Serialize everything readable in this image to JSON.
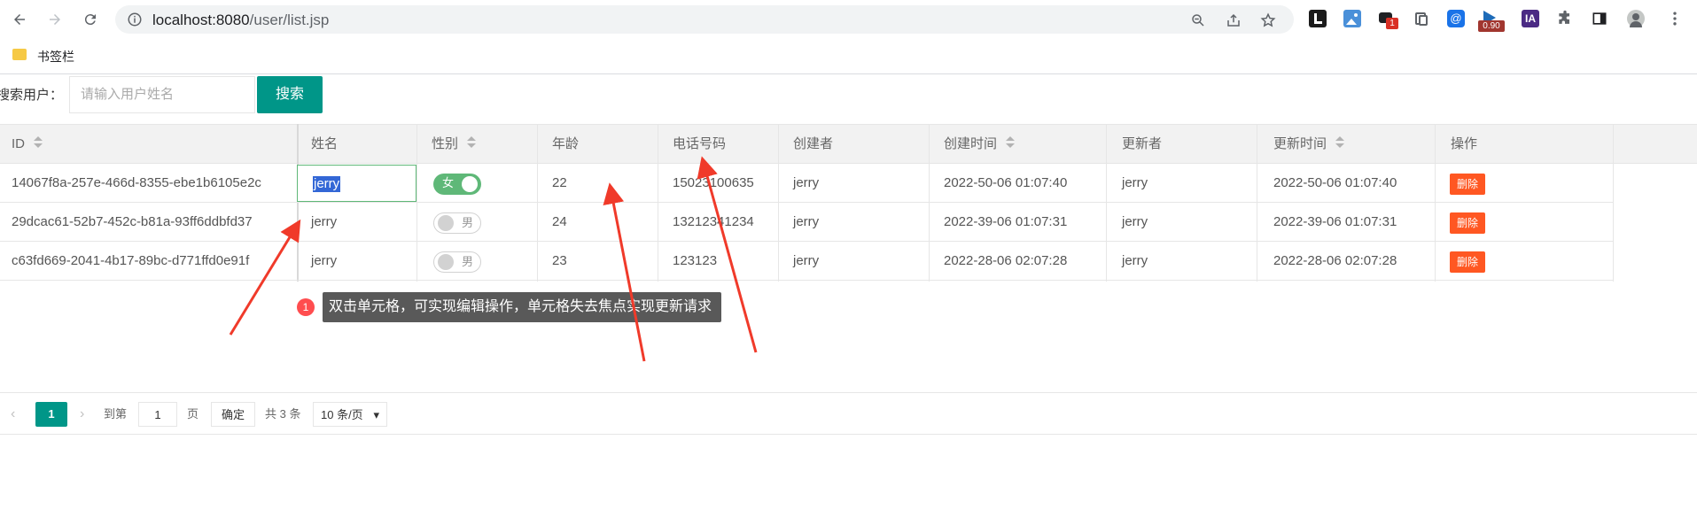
{
  "browser": {
    "url_host": "localhost:8080",
    "url_path": "/user/list.jsp",
    "bookmarks_folder": "书签栏",
    "extension_badges": {
      "notif": "1",
      "version": "0.90",
      "ia": "IA"
    }
  },
  "search": {
    "label": "搜索用户：",
    "placeholder": "请输入用户姓名",
    "button": "搜索"
  },
  "table": {
    "columns": [
      "ID",
      "姓名",
      "性别",
      "年龄",
      "电话号码",
      "创建者",
      "创建时间",
      "更新者",
      "更新时间",
      "操作"
    ],
    "rows": [
      {
        "id": "14067f8a-257e-466d-8355-ebe1b6105e2c",
        "name": "jerry",
        "gender": "女",
        "gender_on": true,
        "age": "22",
        "phone": "15023100635",
        "creator": "jerry",
        "created": "2022-50-06 01:07:40",
        "updater": "jerry",
        "updated": "2022-50-06 01:07:40",
        "action": "删除"
      },
      {
        "id": "29dcac61-52b7-452c-b81a-93ff6ddbfd37",
        "name": "jerry",
        "gender": "男",
        "gender_on": false,
        "age": "24",
        "phone": "13212341234",
        "creator": "jerry",
        "created": "2022-39-06 01:07:31",
        "updater": "jerry",
        "updated": "2022-39-06 01:07:31",
        "action": "删除"
      },
      {
        "id": "c63fd669-2041-4b17-89bc-d771ffd0e91f",
        "name": "jerry",
        "gender": "男",
        "gender_on": false,
        "age": "23",
        "phone": "123123",
        "creator": "jerry",
        "created": "2022-28-06 02:07:28",
        "updater": "jerry",
        "updated": "2022-28-06 02:07:28",
        "action": "删除"
      }
    ]
  },
  "tooltip": {
    "badge": "1",
    "text": "双击单元格，可实现编辑操作，单元格失去焦点实现更新请求"
  },
  "pagination": {
    "current": "1",
    "goto_label": "到第",
    "goto_value": "1",
    "page_label": "页",
    "confirm": "确定",
    "total": "共 3 条",
    "page_size": "10 条/页"
  }
}
